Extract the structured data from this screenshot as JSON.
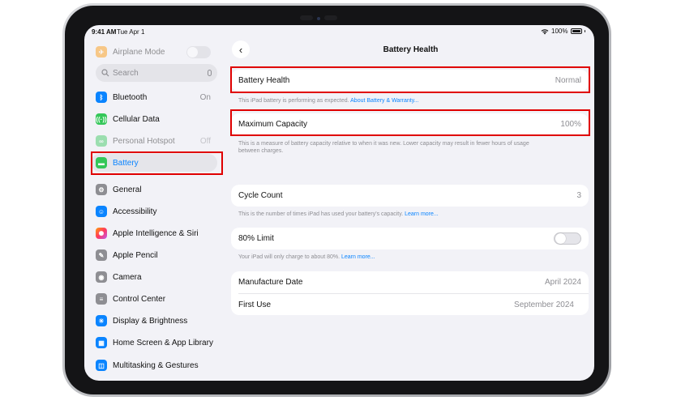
{
  "status": {
    "time": "9:41 AM",
    "date": "Tue Apr 1",
    "battery": "100%"
  },
  "sidebar": {
    "search_placeholder": "Search",
    "items": [
      {
        "label": "Airplane Mode",
        "icon": "airplane-icon",
        "color": "#ff9500",
        "faded": true
      },
      {
        "label": "Bluetooth",
        "value": "On",
        "icon": "bluetooth-icon",
        "color": "#0a84ff"
      },
      {
        "label": "Cellular Data",
        "icon": "antenna-icon",
        "color": "#34c759"
      },
      {
        "label": "Personal Hotspot",
        "value": "Off",
        "icon": "hotspot-icon",
        "color": "#34c759",
        "faded": true
      },
      {
        "label": "Battery",
        "icon": "battery-icon",
        "color": "#34c759",
        "selected": true
      },
      {
        "label": "General",
        "icon": "gear-icon",
        "color": "#8e8e93"
      },
      {
        "label": "Accessibility",
        "icon": "accessibility-icon",
        "color": "#0a84ff"
      },
      {
        "label": "Apple Intelligence & Siri",
        "icon": "siri-icon",
        "color": "#ff6fa3"
      },
      {
        "label": "Apple Pencil",
        "icon": "pencil-icon",
        "color": "#8e8e93"
      },
      {
        "label": "Camera",
        "icon": "camera-icon",
        "color": "#8e8e93"
      },
      {
        "label": "Control Center",
        "icon": "control-center-icon",
        "color": "#8e8e93"
      },
      {
        "label": "Display & Brightness",
        "icon": "sun-icon",
        "color": "#0a84ff"
      },
      {
        "label": "Home Screen & App Library",
        "icon": "home-screen-icon",
        "color": "#0a84ff"
      },
      {
        "label": "Multitasking & Gestures",
        "icon": "multitasking-icon",
        "color": "#0a84ff"
      }
    ]
  },
  "main": {
    "title": "Battery Health",
    "health": {
      "label": "Battery Health",
      "value": "Normal",
      "note": "This iPad battery is performing as expected.",
      "link": "About Battery & Warranty..."
    },
    "capacity": {
      "label": "Maximum Capacity",
      "value": "100%",
      "note": "This is a measure of battery capacity relative to when it was new. Lower capacity may result in fewer hours of usage between charges."
    },
    "cycle": {
      "label": "Cycle Count",
      "value": "3",
      "note": "This is the number of times iPad has used your battery's capacity.",
      "link": "Learn more..."
    },
    "limit": {
      "label": "80% Limit",
      "note": "Your iPad will only charge to about 80%.",
      "link": "Learn more..."
    },
    "dates": [
      {
        "label": "Manufacture Date",
        "value": "April 2024"
      },
      {
        "label": "First Use",
        "value": "September 2024"
      }
    ]
  }
}
